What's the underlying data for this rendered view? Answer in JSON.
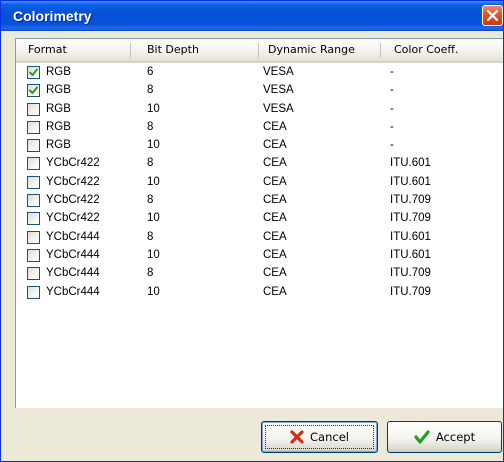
{
  "window": {
    "title": "Colorimetry"
  },
  "columns": [
    {
      "label": "Format"
    },
    {
      "label": "Bit Depth"
    },
    {
      "label": "Dynamic Range"
    },
    {
      "label": "Color Coeff."
    }
  ],
  "rows": [
    {
      "checked": true,
      "format": "RGB",
      "bits": "6",
      "range": "VESA",
      "coeff": "-"
    },
    {
      "checked": true,
      "format": "RGB",
      "bits": "8",
      "range": "VESA",
      "coeff": "-"
    },
    {
      "checked": false,
      "format": "RGB",
      "bits": "10",
      "range": "VESA",
      "coeff": "-"
    },
    {
      "checked": false,
      "format": "RGB",
      "bits": "8",
      "range": "CEA",
      "coeff": "-"
    },
    {
      "checked": false,
      "format": "RGB",
      "bits": "10",
      "range": "CEA",
      "coeff": "-"
    },
    {
      "checked": false,
      "format": "YCbCr422",
      "bits": "8",
      "range": "CEA",
      "coeff": "ITU.601"
    },
    {
      "checked": false,
      "format": "YCbCr422",
      "bits": "10",
      "range": "CEA",
      "coeff": "ITU.601"
    },
    {
      "checked": false,
      "format": "YCbCr422",
      "bits": "8",
      "range": "CEA",
      "coeff": "ITU.709"
    },
    {
      "checked": false,
      "format": "YCbCr422",
      "bits": "10",
      "range": "CEA",
      "coeff": "ITU.709"
    },
    {
      "checked": false,
      "format": "YCbCr444",
      "bits": "8",
      "range": "CEA",
      "coeff": "ITU.601"
    },
    {
      "checked": false,
      "format": "YCbCr444",
      "bits": "10",
      "range": "CEA",
      "coeff": "ITU.601"
    },
    {
      "checked": false,
      "format": "YCbCr444",
      "bits": "8",
      "range": "CEA",
      "coeff": "ITU.709"
    },
    {
      "checked": false,
      "format": "YCbCr444",
      "bits": "10",
      "range": "CEA",
      "coeff": "ITU.709"
    }
  ],
  "buttons": {
    "cancel": {
      "label": "Cancel",
      "icon": "red-x-icon"
    },
    "accept": {
      "label": "Accept",
      "icon": "green-check-icon"
    }
  },
  "colors": {
    "titlebar": "#0551d8",
    "check": "#21a121",
    "cancel_icon": "#d42e12"
  }
}
